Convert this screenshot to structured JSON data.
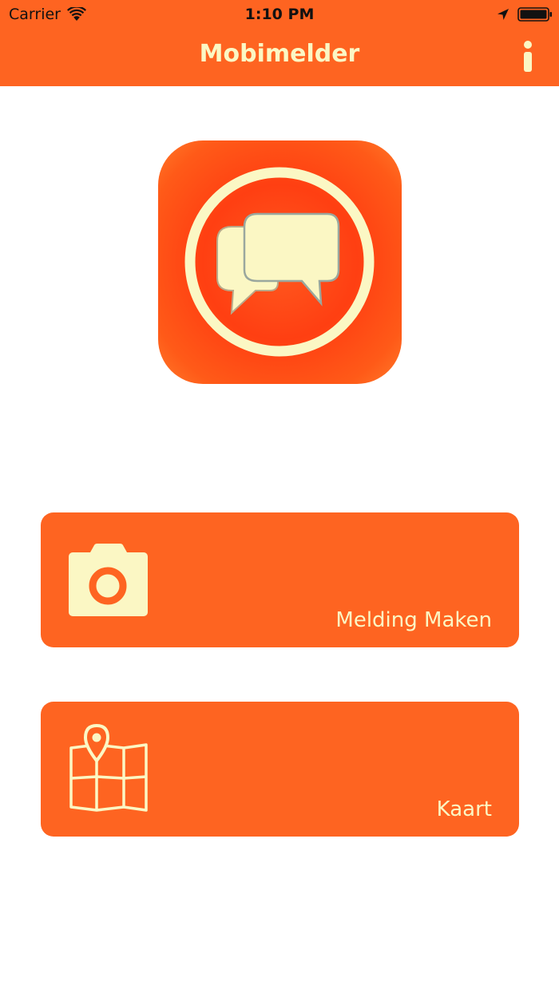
{
  "status_bar": {
    "carrier": "Carrier",
    "time": "1:10 PM",
    "icons": [
      "wifi-icon",
      "location-arrow-icon",
      "battery-icon"
    ]
  },
  "nav_bar": {
    "title": "Mobimelder",
    "info_icon": "info-icon"
  },
  "logo": {
    "icon": "chat-bubbles-icon"
  },
  "actions": [
    {
      "label": "Melding Maken",
      "icon": "camera-icon"
    },
    {
      "label": "Kaart",
      "icon": "map-pin-icon"
    }
  ],
  "colors": {
    "primary": "#fe6421",
    "accent_cream": "#fbf7c4",
    "logo_red": "#ff3f12",
    "background": "#ffffff"
  }
}
